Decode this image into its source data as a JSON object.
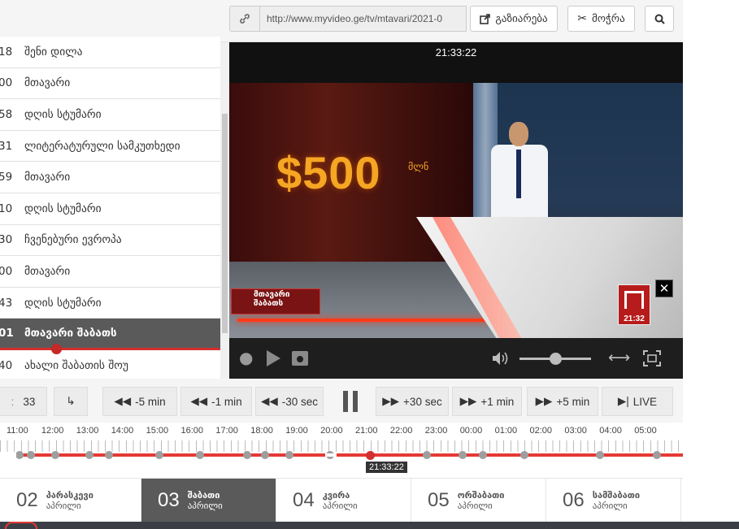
{
  "toolbar": {
    "url": "http://www.myvideo.ge/tv/mtavari/2021-0",
    "share_label": "გაზიარება",
    "cut_label": "მოჭრა"
  },
  "program_list": [
    {
      "time": "18",
      "name": "შენი დილა"
    },
    {
      "time": "00",
      "name": "მთავარი"
    },
    {
      "time": "58",
      "name": "დღის სტუმარი"
    },
    {
      "time": "31",
      "name": "ლიტერატურული სამკუთხედი"
    },
    {
      "time": "59",
      "name": "მთავარი"
    },
    {
      "time": "10",
      "name": "დღის სტუმარი"
    },
    {
      "time": "30",
      "name": "ჩვენებური ევროპა"
    },
    {
      "time": "00",
      "name": "მთავარი"
    },
    {
      "time": "43",
      "name": "დღის სტუმარი"
    },
    {
      "time": "01",
      "name": "მთავარი შაბათს",
      "active": true
    },
    {
      "time": "40",
      "name": "ახალი შაბათის შოუ"
    }
  ],
  "video": {
    "clock": "21:33:22",
    "prize": "$500",
    "prize_suffix": "მლნ",
    "ticker": "მთავარი შაბათს",
    "logo_time": "21:32"
  },
  "controls": {
    "step_value": "33",
    "buttons": [
      "-5 min",
      "-1 min",
      "-30 sec",
      "+30 sec",
      "+1 min",
      "+5 min",
      "LIVE"
    ]
  },
  "timeline": {
    "hours": [
      "11:00",
      "12:00",
      "13:00",
      "14:00",
      "15:00",
      "16:00",
      "17:00",
      "18:00",
      "19:00",
      "20:00",
      "21:00",
      "22:00",
      "23:00",
      "00:00",
      "01:00",
      "02:00",
      "03:00",
      "04:00",
      "05:00"
    ],
    "current": "21:33:22"
  },
  "days": [
    {
      "num": "02",
      "day": "პარასკევი",
      "month": "აპრილი"
    },
    {
      "num": "03",
      "day": "შაბათი",
      "month": "აპრილი",
      "active": true
    },
    {
      "num": "04",
      "day": "კვირა",
      "month": "აპრილი"
    },
    {
      "num": "05",
      "day": "ორშაბათი",
      "month": "აპრილი"
    },
    {
      "num": "06",
      "day": "სამშაბათი",
      "month": "აპრილი"
    }
  ],
  "colors": {
    "accent": "#e53935",
    "active_bg": "#5a5a5a"
  }
}
